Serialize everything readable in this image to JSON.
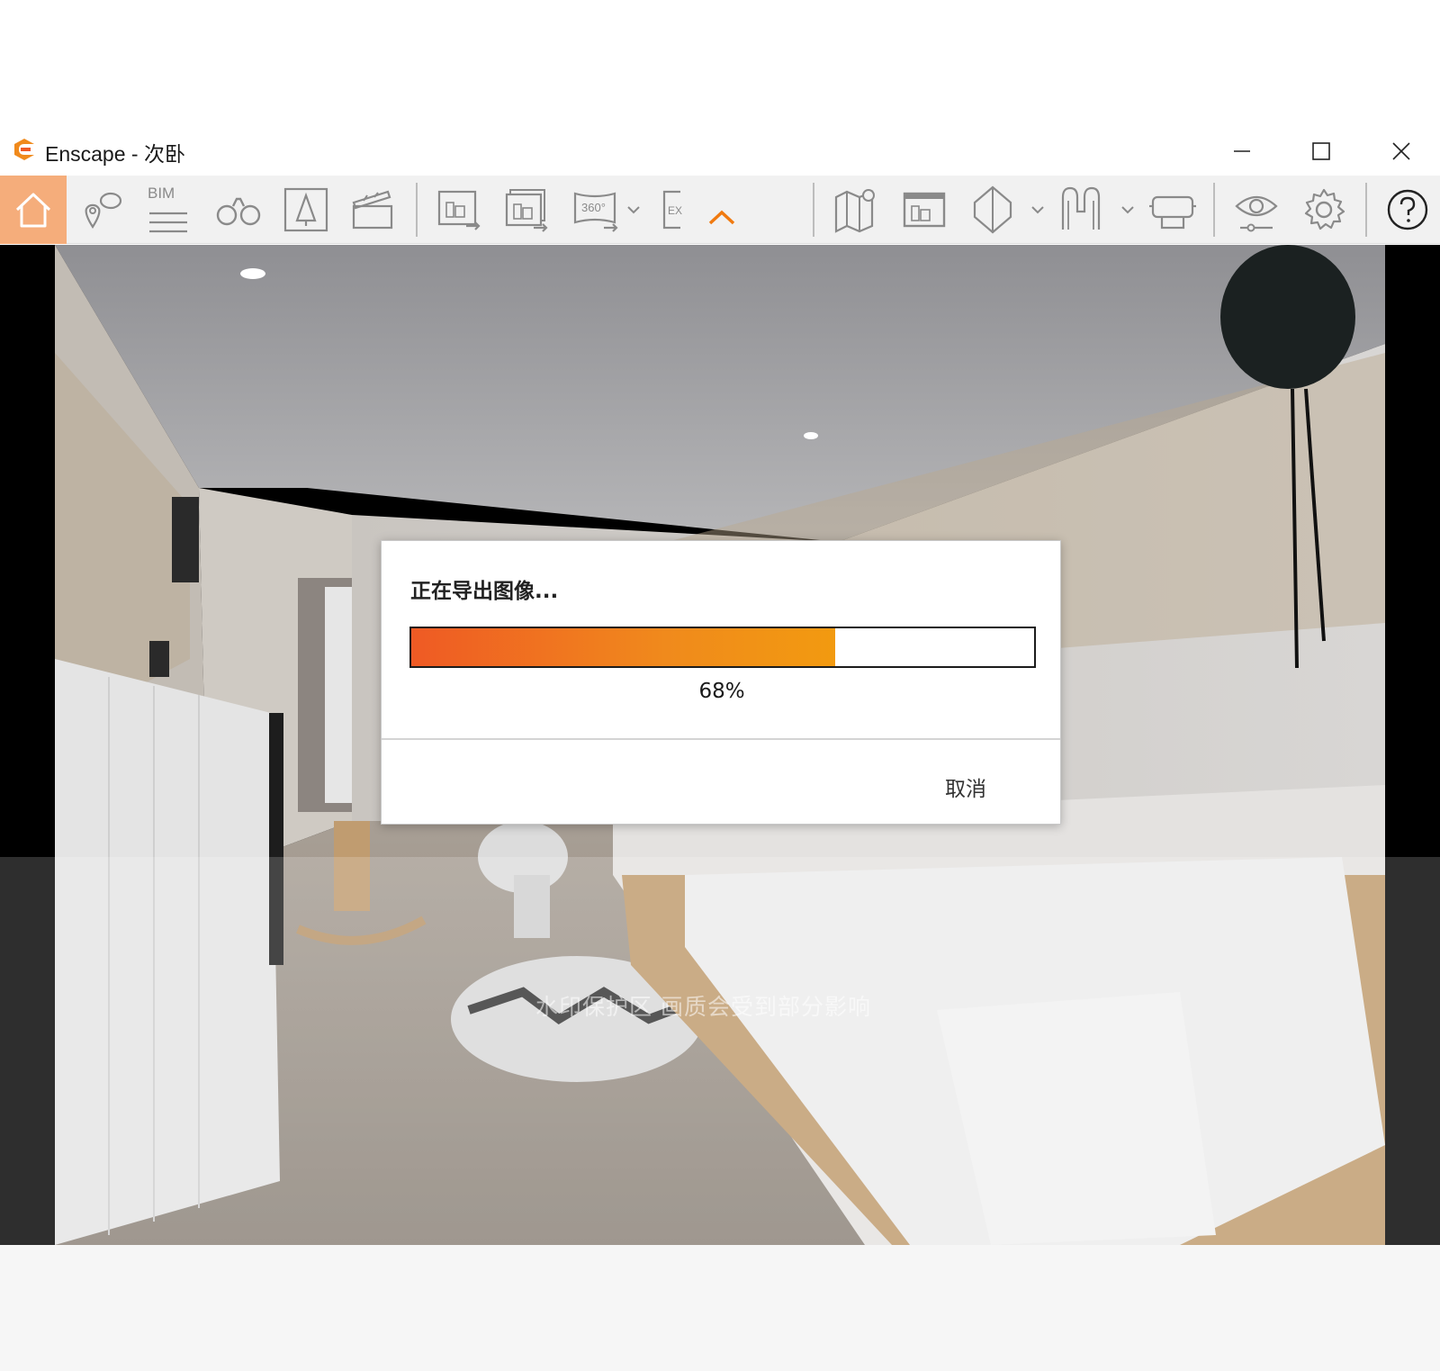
{
  "window": {
    "title": "Enscape - 次卧",
    "logo_icon": "enscape-logo-icon",
    "controls": [
      "minimize-icon",
      "maximize-icon",
      "close-icon"
    ]
  },
  "toolbar": {
    "accent_color": "#f5ad7b",
    "bim_label": "BIM",
    "items": [
      "home-icon",
      "views-pins-icon",
      "bim-info-icon",
      "binoculars-icon",
      "asset-library-icon",
      "video-editor-icon",
      "screenshot-export-icon",
      "batch-render-icon",
      "panorama-360-icon",
      "export-icon",
      "collapse-toolbar-icon",
      "map-icon",
      "atlas-icon",
      "cube-view-icon",
      "material-editor-icon",
      "vr-headset-icon",
      "visual-settings-icon",
      "settings-icon",
      "help-icon"
    ]
  },
  "viewport": {
    "watermark_text": "水印保护区   画质会受到部分影响"
  },
  "dialog": {
    "title": "正在导出图像...",
    "progress_percent": 68,
    "progress_label": "68%",
    "cancel_label": "取消"
  }
}
